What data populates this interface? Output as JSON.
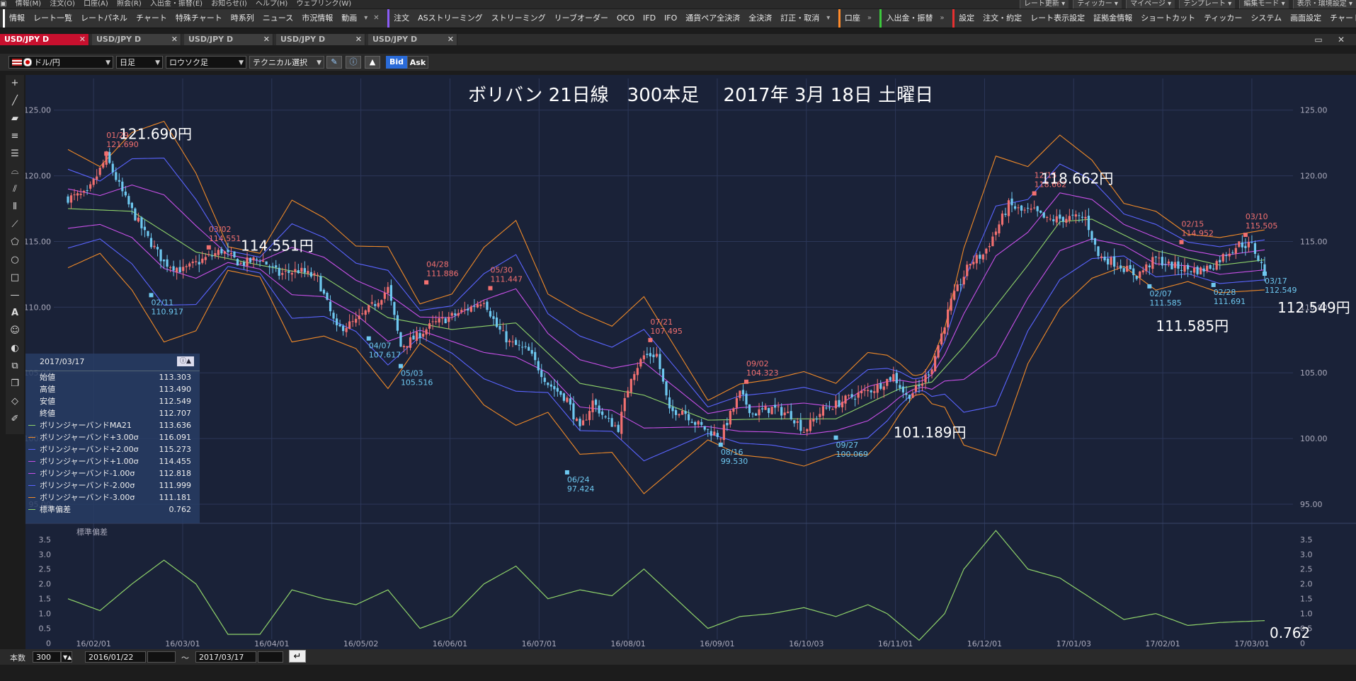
{
  "menubar": {
    "items": [
      "情報(M)",
      "注文(O)",
      "口座(A)",
      "照会(R)",
      "入出金・振替(E)",
      "お知らせ(I)",
      "ヘルプ(H)",
      "ウェブリンク(W)"
    ],
    "right_items": [
      "レート更新 ▾",
      "ティッカー ▾",
      "マイページ ▾",
      "テンプレート ▾",
      "編集モード ▾",
      "表示・環境設定 ▾"
    ]
  },
  "toolbar": {
    "group1_label": "情報",
    "group1_items": [
      "レート一覧",
      "レートパネル",
      "チャート",
      "特殊チャート",
      "時系列",
      "ニュース",
      "市況情報",
      "動画"
    ],
    "group2_label": "注文",
    "group2_items": [
      "ASストリーミング",
      "ストリーミング",
      "リーブオーダー",
      "OCO",
      "IFD",
      "IFO",
      "通貨ペア全決済",
      "全決済",
      "訂正・取消"
    ],
    "group3_label": "口座",
    "group4_label": "入出金・振替",
    "group5_label": "設定",
    "group5_items": [
      "注文・約定",
      "レート表示設定",
      "証拠金情報",
      "ショートカット",
      "ティッカー",
      "システム",
      "画面設定",
      "チャート"
    ],
    "colors": {
      "group1": "#ffffff",
      "group2": "#8a5cf5",
      "group3": "#ff8a2a",
      "group4": "#3cc83c",
      "group5": "#e83030"
    }
  },
  "tabs": [
    {
      "label": "USD/JPY D",
      "active": true
    },
    {
      "label": "USD/JPY D",
      "active": false
    },
    {
      "label": "USD/JPY D",
      "active": false
    },
    {
      "label": "USD/JPY D",
      "active": false
    },
    {
      "label": "USD/JPY D",
      "active": false
    }
  ],
  "controls": {
    "pair": "ドル/円",
    "period": "日足",
    "chart_type": "ロウソク足",
    "technical": "テクニカル選択",
    "bid": "Bid",
    "ask": "Ask"
  },
  "bottombar": {
    "count_label": "本数",
    "count_value": "300",
    "start_date": "2016/01/22",
    "tilde": "～",
    "end_date": "2017/03/17"
  },
  "infopanel": {
    "date": "2017/03/17",
    "rows": [
      {
        "k": "始値",
        "v": "113.303",
        "color": ""
      },
      {
        "k": "高値",
        "v": "113.490",
        "color": ""
      },
      {
        "k": "安値",
        "v": "112.549",
        "color": ""
      },
      {
        "k": "終値",
        "v": "112.707",
        "color": ""
      },
      {
        "k": "ボリンジャーバンドMA21",
        "v": "113.636",
        "color": "#8fd36a"
      },
      {
        "k": "ボリンジャーバンド+3.00σ",
        "v": "116.091",
        "color": "#f08a28"
      },
      {
        "k": "ボリンジャーバンド+2.00σ",
        "v": "115.273",
        "color": "#5a64ff"
      },
      {
        "k": "ボリンジャーバンド+1.00σ",
        "v": "114.455",
        "color": "#c850e8"
      },
      {
        "k": "ボリンジャーバンド-1.00σ",
        "v": "112.818",
        "color": "#c850e8"
      },
      {
        "k": "ボリンジャーバンド-2.00σ",
        "v": "111.999",
        "color": "#5a64ff"
      },
      {
        "k": "ボリンジャーバンド-3.00σ",
        "v": "111.181",
        "color": "#f08a28"
      },
      {
        "k": "標準偏差",
        "v": "0.762",
        "color": "#8fd36a"
      }
    ]
  },
  "chart_data": {
    "type": "candlestick",
    "title": "ボリバン 21日線　300本足　 2017年 3月 18日 土曜日",
    "ylim": [
      94.3,
      126.6
    ],
    "y_ticks": [
      "125.00",
      "120.00",
      "115.00",
      "110.00",
      "105.00",
      "100.00",
      "95.00"
    ],
    "x_ticks": [
      "16/02/01",
      "16/03/01",
      "16/04/01",
      "16/05/02",
      "16/06/01",
      "16/07/01",
      "16/08/01",
      "16/09/01",
      "16/10/03",
      "16/11/01",
      "16/12/01",
      "17/01/03",
      "17/02/01",
      "17/03/01"
    ],
    "close_path": [
      [
        0,
        118.3
      ],
      [
        6,
        118.6
      ],
      [
        12,
        121.4
      ],
      [
        18,
        118.2
      ],
      [
        24,
        115.6
      ],
      [
        30,
        113.4
      ],
      [
        36,
        112.8
      ],
      [
        42,
        113.6
      ],
      [
        48,
        114.3
      ],
      [
        54,
        113.3
      ],
      [
        60,
        113.7
      ],
      [
        66,
        112.5
      ],
      [
        72,
        112.8
      ],
      [
        78,
        112.2
      ],
      [
        84,
        108.3
      ],
      [
        90,
        108.9
      ],
      [
        96,
        110.3
      ],
      [
        100,
        111.4
      ],
      [
        104,
        107.0
      ],
      [
        108,
        107.6
      ],
      [
        114,
        108.7
      ],
      [
        120,
        109.3
      ],
      [
        126,
        110.0
      ],
      [
        130,
        110.6
      ],
      [
        134,
        108.5
      ],
      [
        138,
        107.3
      ],
      [
        144,
        106.6
      ],
      [
        150,
        104.2
      ],
      [
        156,
        103.0
      ],
      [
        160,
        100.6
      ],
      [
        164,
        102.8
      ],
      [
        168,
        101.5
      ],
      [
        172,
        100.8
      ],
      [
        176,
        104.8
      ],
      [
        180,
        106.3
      ],
      [
        184,
        106.4
      ],
      [
        188,
        102.0
      ],
      [
        192,
        102.2
      ],
      [
        196,
        101.2
      ],
      [
        200,
        100.6
      ],
      [
        204,
        100.2
      ],
      [
        210,
        103.4
      ],
      [
        214,
        101.9
      ],
      [
        220,
        102.3
      ],
      [
        226,
        101.8
      ],
      [
        230,
        100.6
      ],
      [
        236,
        102.2
      ],
      [
        240,
        102.6
      ],
      [
        246,
        103.3
      ],
      [
        252,
        103.8
      ],
      [
        258,
        104.8
      ],
      [
        262,
        103.2
      ],
      [
        266,
        103.9
      ],
      [
        270,
        105.5
      ],
      [
        276,
        110.4
      ],
      [
        282,
        113.4
      ],
      [
        286,
        114.0
      ],
      [
        290,
        115.8
      ],
      [
        294,
        117.8
      ],
      [
        298,
        117.3
      ],
      [
        302,
        117.3
      ],
      [
        306,
        116.6
      ],
      [
        312,
        116.8
      ],
      [
        318,
        116.8
      ],
      [
        322,
        113.9
      ],
      [
        328,
        113.3
      ],
      [
        334,
        112.4
      ],
      [
        340,
        113.7
      ],
      [
        344,
        113.2
      ],
      [
        350,
        112.9
      ],
      [
        354,
        112.8
      ],
      [
        358,
        113.2
      ],
      [
        362,
        114.1
      ],
      [
        366,
        114.8
      ],
      [
        370,
        114.7
      ],
      [
        374,
        112.7
      ]
    ],
    "bb_basis_path": [
      [
        0,
        117.5
      ],
      [
        20,
        117.3
      ],
      [
        40,
        114.2
      ],
      [
        60,
        113.2
      ],
      [
        80,
        112.3
      ],
      [
        100,
        109.2
      ],
      [
        120,
        108.3
      ],
      [
        140,
        108.8
      ],
      [
        160,
        104.2
      ],
      [
        180,
        103.3
      ],
      [
        200,
        101.4
      ],
      [
        220,
        101.5
      ],
      [
        240,
        101.5
      ],
      [
        260,
        103.8
      ],
      [
        270,
        104.3
      ],
      [
        280,
        107.0
      ],
      [
        300,
        113.2
      ],
      [
        310,
        116.5
      ],
      [
        320,
        116.7
      ],
      [
        340,
        114.3
      ],
      [
        360,
        113.2
      ],
      [
        374,
        113.6
      ]
    ],
    "bb_sd_path": [
      [
        0,
        1.5
      ],
      [
        10,
        1.1
      ],
      [
        20,
        2.0
      ],
      [
        30,
        2.8
      ],
      [
        40,
        2.0
      ],
      [
        50,
        0.3
      ],
      [
        60,
        0.3
      ],
      [
        70,
        1.8
      ],
      [
        80,
        1.5
      ],
      [
        90,
        1.3
      ],
      [
        100,
        1.8
      ],
      [
        110,
        0.5
      ],
      [
        120,
        0.9
      ],
      [
        130,
        2.0
      ],
      [
        140,
        2.6
      ],
      [
        150,
        1.5
      ],
      [
        160,
        1.8
      ],
      [
        170,
        1.6
      ],
      [
        180,
        2.5
      ],
      [
        190,
        1.5
      ],
      [
        200,
        0.5
      ],
      [
        210,
        0.9
      ],
      [
        220,
        1.0
      ],
      [
        230,
        1.2
      ],
      [
        240,
        0.9
      ],
      [
        250,
        1.3
      ],
      [
        256,
        1.0
      ],
      [
        266,
        0.1
      ],
      [
        274,
        1.0
      ],
      [
        280,
        2.5
      ],
      [
        290,
        3.8
      ],
      [
        300,
        2.5
      ],
      [
        310,
        2.2
      ],
      [
        320,
        1.5
      ],
      [
        330,
        0.8
      ],
      [
        340,
        1.0
      ],
      [
        350,
        0.6
      ],
      [
        360,
        0.7
      ],
      [
        374,
        0.762
      ]
    ],
    "band_styles": [
      {
        "k": 3,
        "color": "#f08a28"
      },
      {
        "k": 2,
        "color": "#5a64ff"
      },
      {
        "k": 1,
        "color": "#c850e8"
      },
      {
        "k": 0,
        "color": "#8fd36a"
      },
      {
        "k": -1,
        "color": "#c850e8"
      },
      {
        "k": -2,
        "color": "#5a64ff"
      },
      {
        "k": -3,
        "color": "#f08a28"
      }
    ],
    "markers": [
      {
        "bar": 12,
        "price": 121.69,
        "date": "01/29",
        "val": "121.690",
        "type": "high"
      },
      {
        "bar": 44,
        "price": 114.551,
        "date": "03/02",
        "val": "114.551",
        "type": "high"
      },
      {
        "bar": 112,
        "price": 111.886,
        "date": "04/28",
        "val": "111.886",
        "type": "high"
      },
      {
        "bar": 132,
        "price": 111.447,
        "date": "05/30",
        "val": "111.447",
        "type": "high"
      },
      {
        "bar": 182,
        "price": 107.495,
        "date": "07/21",
        "val": "107.495",
        "type": "high"
      },
      {
        "bar": 212,
        "price": 104.323,
        "date": "09/02",
        "val": "104.323",
        "type": "high"
      },
      {
        "bar": 302,
        "price": 118.662,
        "date": "12/15",
        "val": "118.662",
        "type": "high"
      },
      {
        "bar": 348,
        "price": 114.952,
        "date": "02/15",
        "val": "114.952",
        "type": "high"
      },
      {
        "bar": 368,
        "price": 115.505,
        "date": "03/10",
        "val": "115.505",
        "type": "high"
      },
      {
        "bar": 26,
        "price": 110.917,
        "date": "02/11",
        "val": "110.917",
        "type": "low"
      },
      {
        "bar": 94,
        "price": 107.617,
        "date": "04/07",
        "val": "107.617",
        "type": "low"
      },
      {
        "bar": 104,
        "price": 105.516,
        "date": "05/03",
        "val": "105.516",
        "type": "low"
      },
      {
        "bar": 156,
        "price": 97.424,
        "date": "06/24",
        "val": "97.424",
        "type": "low"
      },
      {
        "bar": 204,
        "price": 99.53,
        "date": "08/16",
        "val": "99.530",
        "type": "low"
      },
      {
        "bar": 240,
        "price": 100.069,
        "date": "09/27",
        "val": "100.069",
        "type": "low"
      },
      {
        "bar": 338,
        "price": 111.585,
        "date": "02/07",
        "val": "111.585",
        "type": "low"
      },
      {
        "bar": 358,
        "price": 111.691,
        "date": "02/28",
        "val": "111.691",
        "type": "low"
      },
      {
        "bar": 374,
        "price": 112.549,
        "date": "03/17",
        "val": "112.549",
        "type": "low"
      }
    ],
    "annotations": [
      {
        "bar": 16,
        "price": 122.8,
        "text": "121.690円"
      },
      {
        "bar": 54,
        "price": 114.3,
        "text": "114.551円"
      },
      {
        "bar": 304,
        "price": 119.4,
        "text": "118.662円"
      },
      {
        "bar": 258,
        "price": 100.1,
        "text": "101.189円"
      },
      {
        "bar": 340,
        "price": 108.2,
        "text": "111.585円"
      },
      {
        "bar": 378,
        "price": 109.6,
        "text": "112.549円"
      }
    ],
    "sd_label": "標準偏差",
    "sd_ylim": [
      -0.2,
      3.9
    ],
    "sd_ticks": [
      "3.5",
      "3.0",
      "2.5",
      "2.0",
      "1.5",
      "1.0",
      "0.5",
      "0"
    ],
    "sd_value_label": "0.762"
  }
}
